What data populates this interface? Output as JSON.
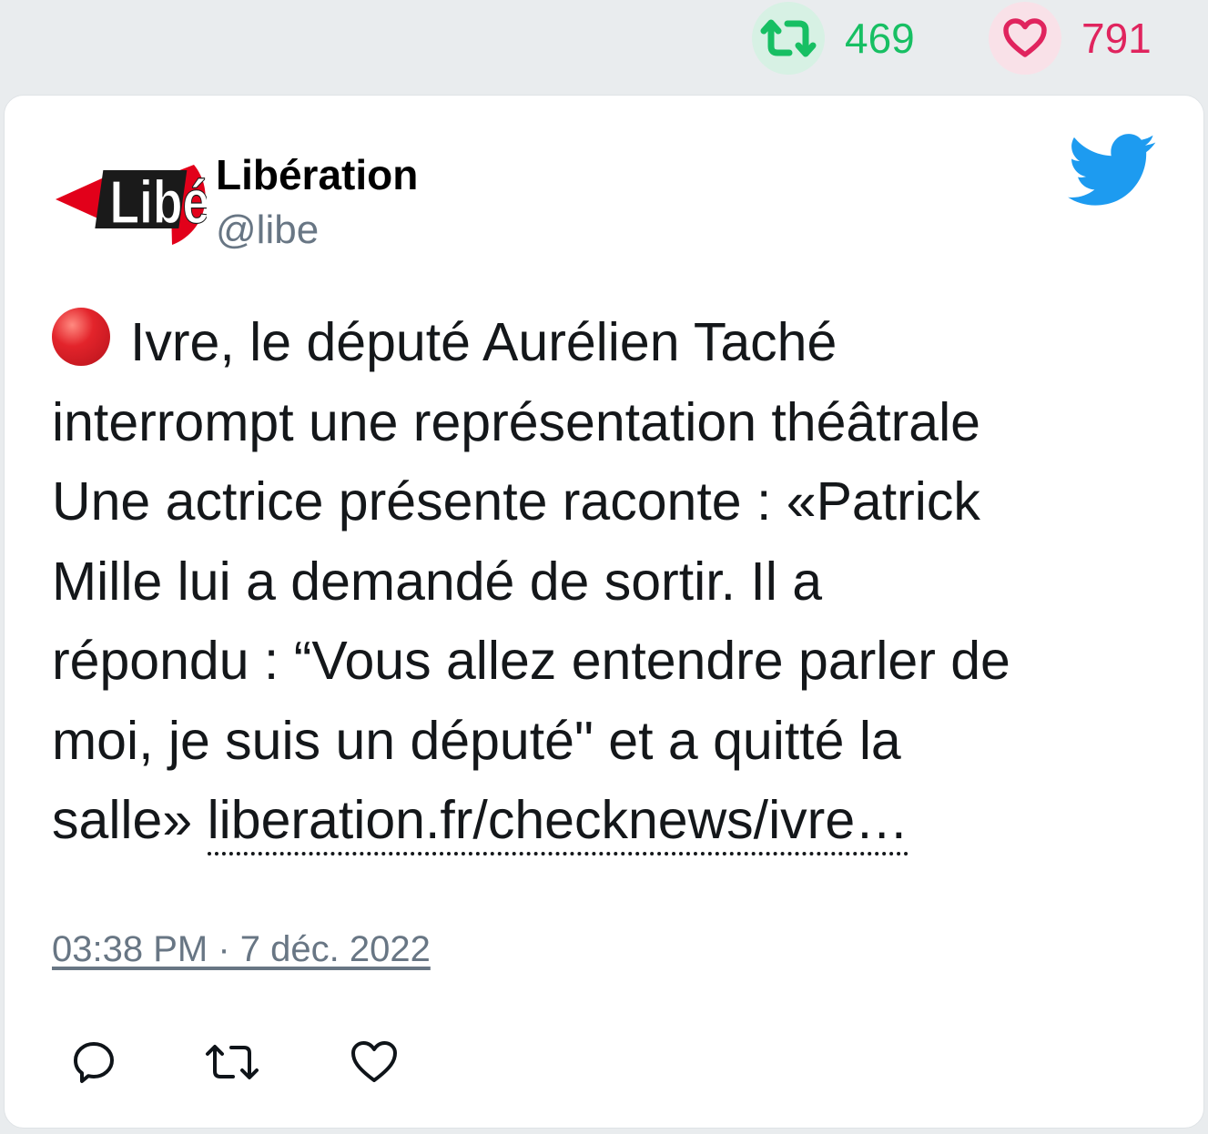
{
  "stats": {
    "retweet_count": "469",
    "like_count": "791",
    "retweet_color": "#17bf63",
    "like_color": "#e0245e"
  },
  "tweet": {
    "author_name": "Libération",
    "author_handle": "@libe",
    "avatar_logo_text": "Libé",
    "lines": [
      "Ivre, le député Aurélien Taché",
      "interrompt une représentation théâtrale",
      "Une actrice présente raconte : «Patrick",
      "Mille lui a demandé de sortir. Il a",
      "répondu : “Vous allez entendre parler de",
      "moi, je suis un député\" et a quitté la",
      "salle»"
    ],
    "link_text": "liberation.fr/checknews/ivre…",
    "leading_emoji": "red-circle",
    "timestamp": "03:38 PM · 7 déc. 2022"
  },
  "icons": {
    "brand": "twitter-bird-icon",
    "actions": [
      "reply-icon",
      "retweet-icon",
      "like-icon"
    ]
  }
}
